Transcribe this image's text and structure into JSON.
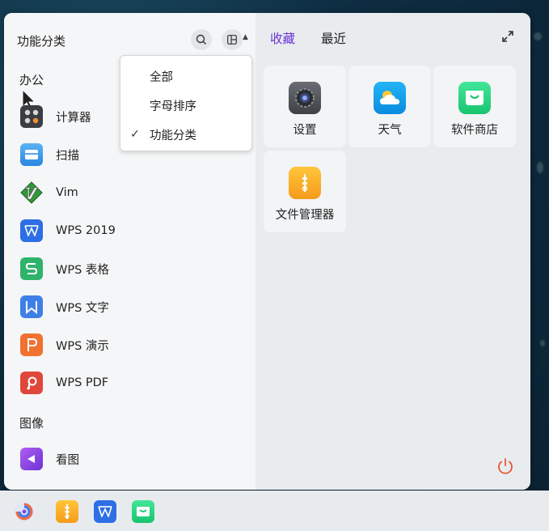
{
  "left_panel": {
    "title": "功能分类",
    "sections": [
      {
        "label": "办公"
      },
      {
        "label": "图像"
      }
    ],
    "apps": [
      {
        "label": "计算器",
        "icon": "calculator-icon"
      },
      {
        "label": "扫描",
        "icon": "scanner-icon"
      },
      {
        "label": "Vim",
        "icon": "vim-icon"
      },
      {
        "label": "WPS 2019",
        "icon": "wps-icon"
      },
      {
        "label": "WPS 表格",
        "icon": "wps-spreadsheet-icon"
      },
      {
        "label": "WPS 文字",
        "icon": "wps-writer-icon"
      },
      {
        "label": "WPS 演示",
        "icon": "wps-presentation-icon"
      },
      {
        "label": "WPS PDF",
        "icon": "wps-pdf-icon"
      },
      {
        "label": "看图",
        "icon": "image-viewer-icon"
      }
    ]
  },
  "sort_menu": {
    "items": [
      {
        "label": "全部",
        "checked": false
      },
      {
        "label": "字母排序",
        "checked": false
      },
      {
        "label": "功能分类",
        "checked": true
      }
    ],
    "check_mark": "✓"
  },
  "right_panel": {
    "tabs": [
      {
        "label": "收藏",
        "active": true
      },
      {
        "label": "最近",
        "active": false
      }
    ],
    "favorites": [
      {
        "label": "设置",
        "icon": "settings-icon"
      },
      {
        "label": "天气",
        "icon": "weather-icon"
      },
      {
        "label": "软件商店",
        "icon": "software-store-icon"
      },
      {
        "label": "文件管理器",
        "icon": "file-manager-icon"
      }
    ]
  },
  "taskbar": {
    "icons": [
      "start-menu-icon",
      "file-manager-icon",
      "wps-icon",
      "software-store-icon"
    ]
  },
  "colors": {
    "accent": "#6b33d6",
    "power": "#e8552f",
    "wps_blue": "#2e6ee6",
    "wps_green": "#2fb36b",
    "wps_orange": "#f07130",
    "wps_red": "#e0473b"
  }
}
